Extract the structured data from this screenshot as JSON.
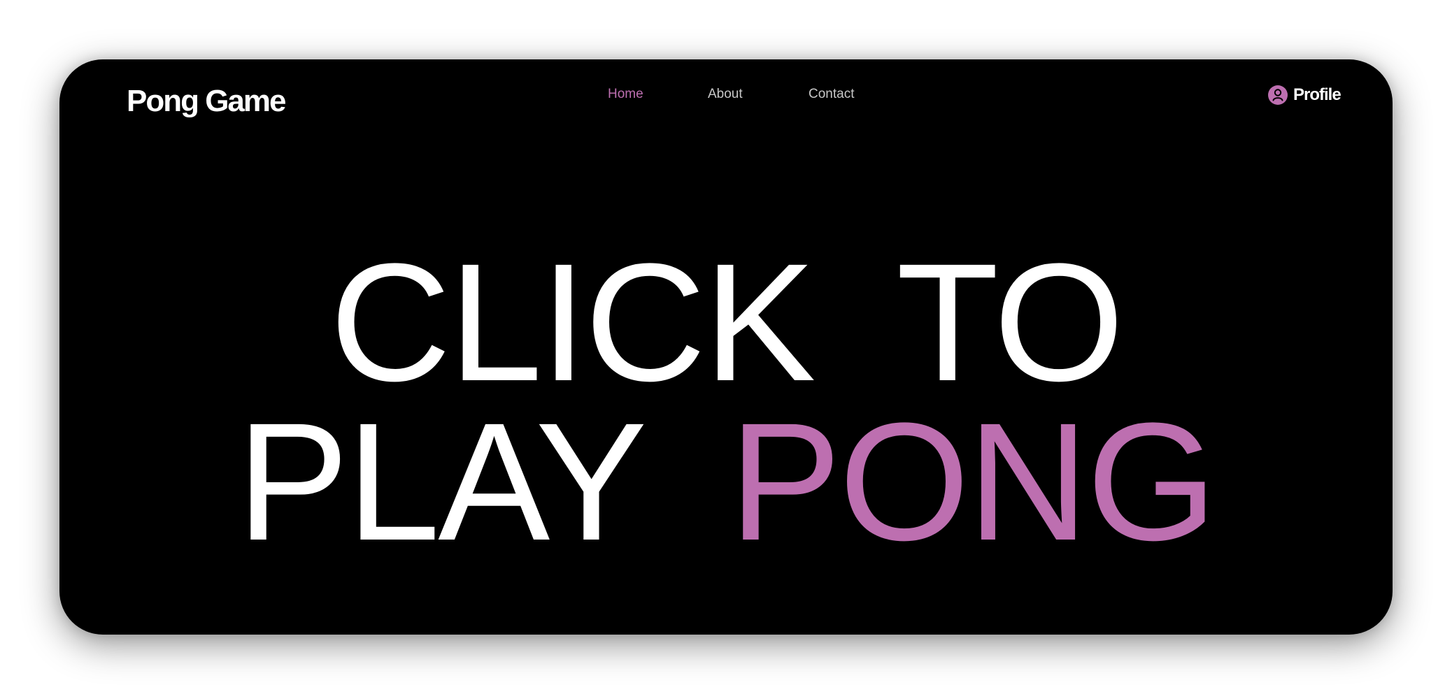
{
  "app": {
    "brand": "Pong Game"
  },
  "nav": {
    "items": [
      {
        "label": "Home",
        "active": true
      },
      {
        "label": "About",
        "active": false
      },
      {
        "label": "Contact",
        "active": false
      }
    ]
  },
  "profile": {
    "label": "Profile",
    "icon": "user-circle-icon"
  },
  "hero": {
    "line1_word1": "CLICK",
    "line1_word2": "TO",
    "line2_word1": "PLAY",
    "line2_word2": "PONG"
  },
  "colors": {
    "background": "#000000",
    "text": "#ffffff",
    "accent": "#bd6fb0",
    "nav_text": "#c8c8c8"
  }
}
